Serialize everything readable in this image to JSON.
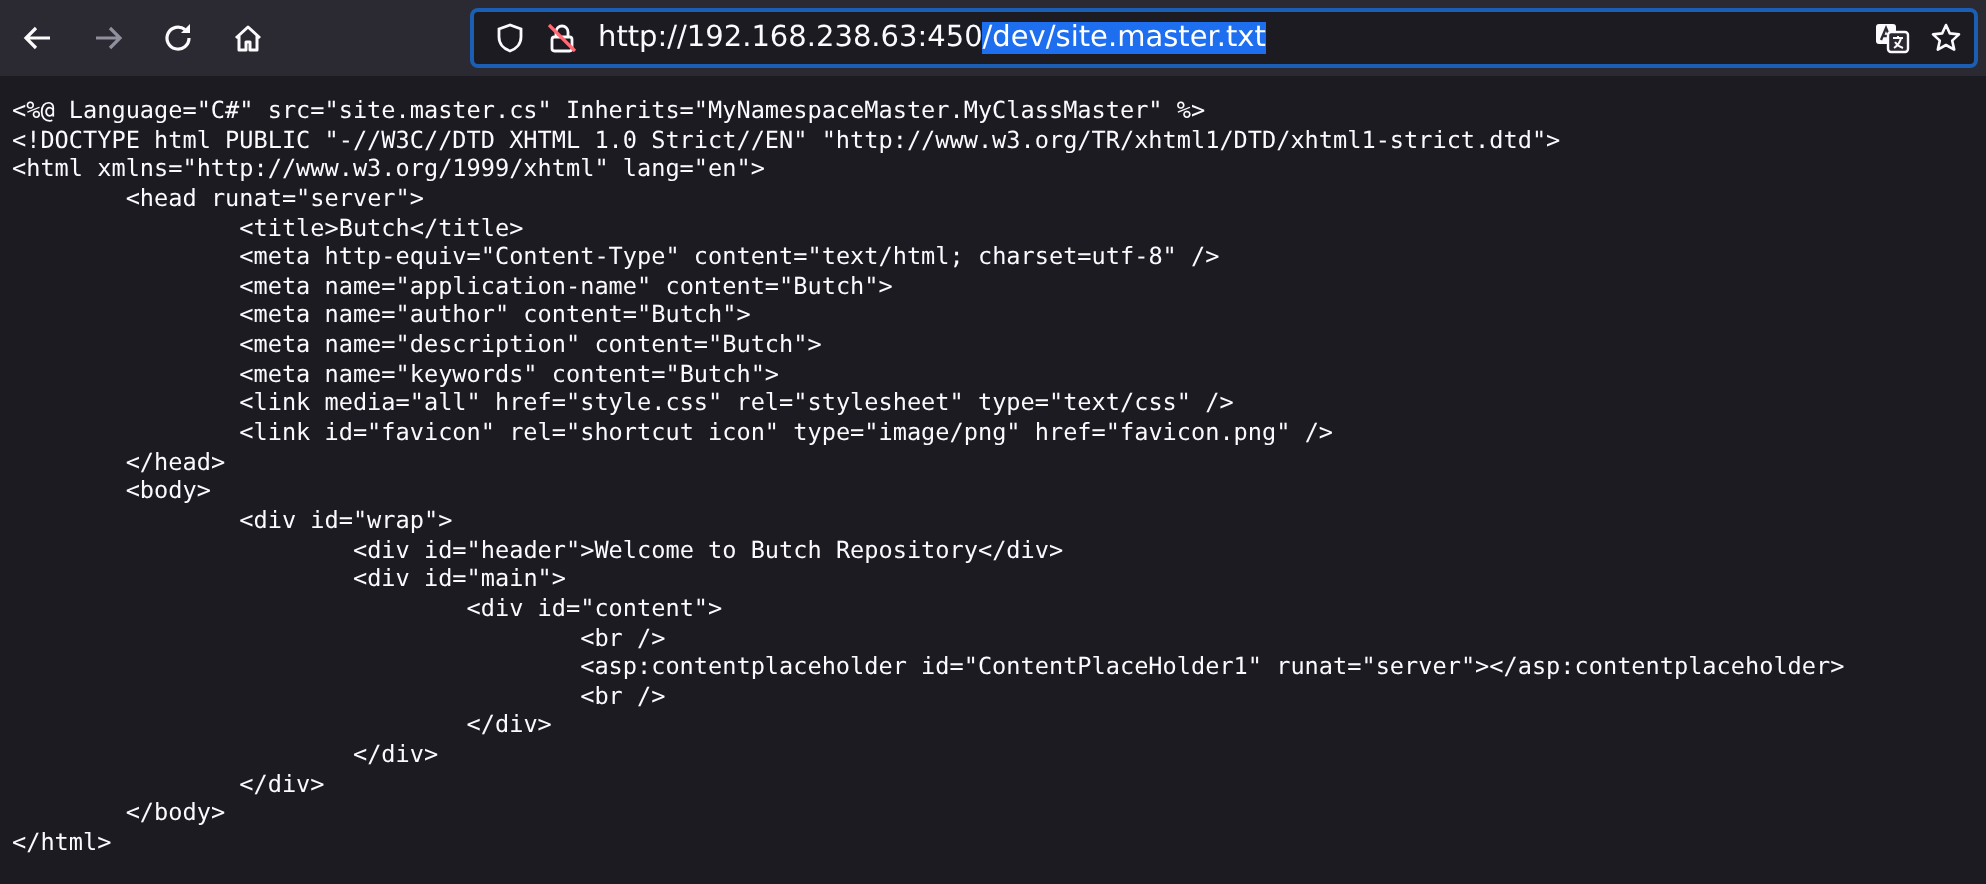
{
  "toolbar": {
    "buttons": [
      {
        "kind": "back",
        "disabled": false
      },
      {
        "kind": "forward",
        "disabled": true
      },
      {
        "kind": "reload",
        "disabled": false
      },
      {
        "kind": "home",
        "disabled": false
      }
    ]
  },
  "address_bar": {
    "focused": true,
    "segments": [
      {
        "text": "http://192.168.238.63:450",
        "selected": false
      },
      {
        "text": "/dev/site.master.txt",
        "selected": true
      }
    ]
  },
  "document": {
    "lines": [
      "<%@ Language=\"C#\" src=\"site.master.cs\" Inherits=\"MyNamespaceMaster.MyClassMaster\" %>",
      "<!DOCTYPE html PUBLIC \"-//W3C//DTD XHTML 1.0 Strict//EN\" \"http://www.w3.org/TR/xhtml1/DTD/xhtml1-strict.dtd\">",
      "<html xmlns=\"http://www.w3.org/1999/xhtml\" lang=\"en\">",
      "\t<head runat=\"server\">",
      "\t\t<title>Butch</title>",
      "\t\t<meta http-equiv=\"Content-Type\" content=\"text/html; charset=utf-8\" />",
      "\t\t<meta name=\"application-name\" content=\"Butch\">",
      "\t\t<meta name=\"author\" content=\"Butch\">",
      "\t\t<meta name=\"description\" content=\"Butch\">",
      "\t\t<meta name=\"keywords\" content=\"Butch\">",
      "\t\t<link media=\"all\" href=\"style.css\" rel=\"stylesheet\" type=\"text/css\" />",
      "\t\t<link id=\"favicon\" rel=\"shortcut icon\" type=\"image/png\" href=\"favicon.png\" />",
      "\t</head>",
      "\t<body>",
      "\t\t<div id=\"wrap\">",
      "\t\t\t<div id=\"header\">Welcome to Butch Repository</div>",
      "\t\t\t<div id=\"main\">",
      "\t\t\t\t<div id=\"content\">",
      "\t\t\t\t\t<br />",
      "\t\t\t\t\t<asp:contentplaceholder id=\"ContentPlaceHolder1\" runat=\"server\"></asp:contentplaceholder>",
      "\t\t\t\t\t<br />",
      "\t\t\t\t</div>",
      "\t\t\t</div>",
      "\t\t</div>",
      "\t</body>",
      "</html>"
    ]
  }
}
